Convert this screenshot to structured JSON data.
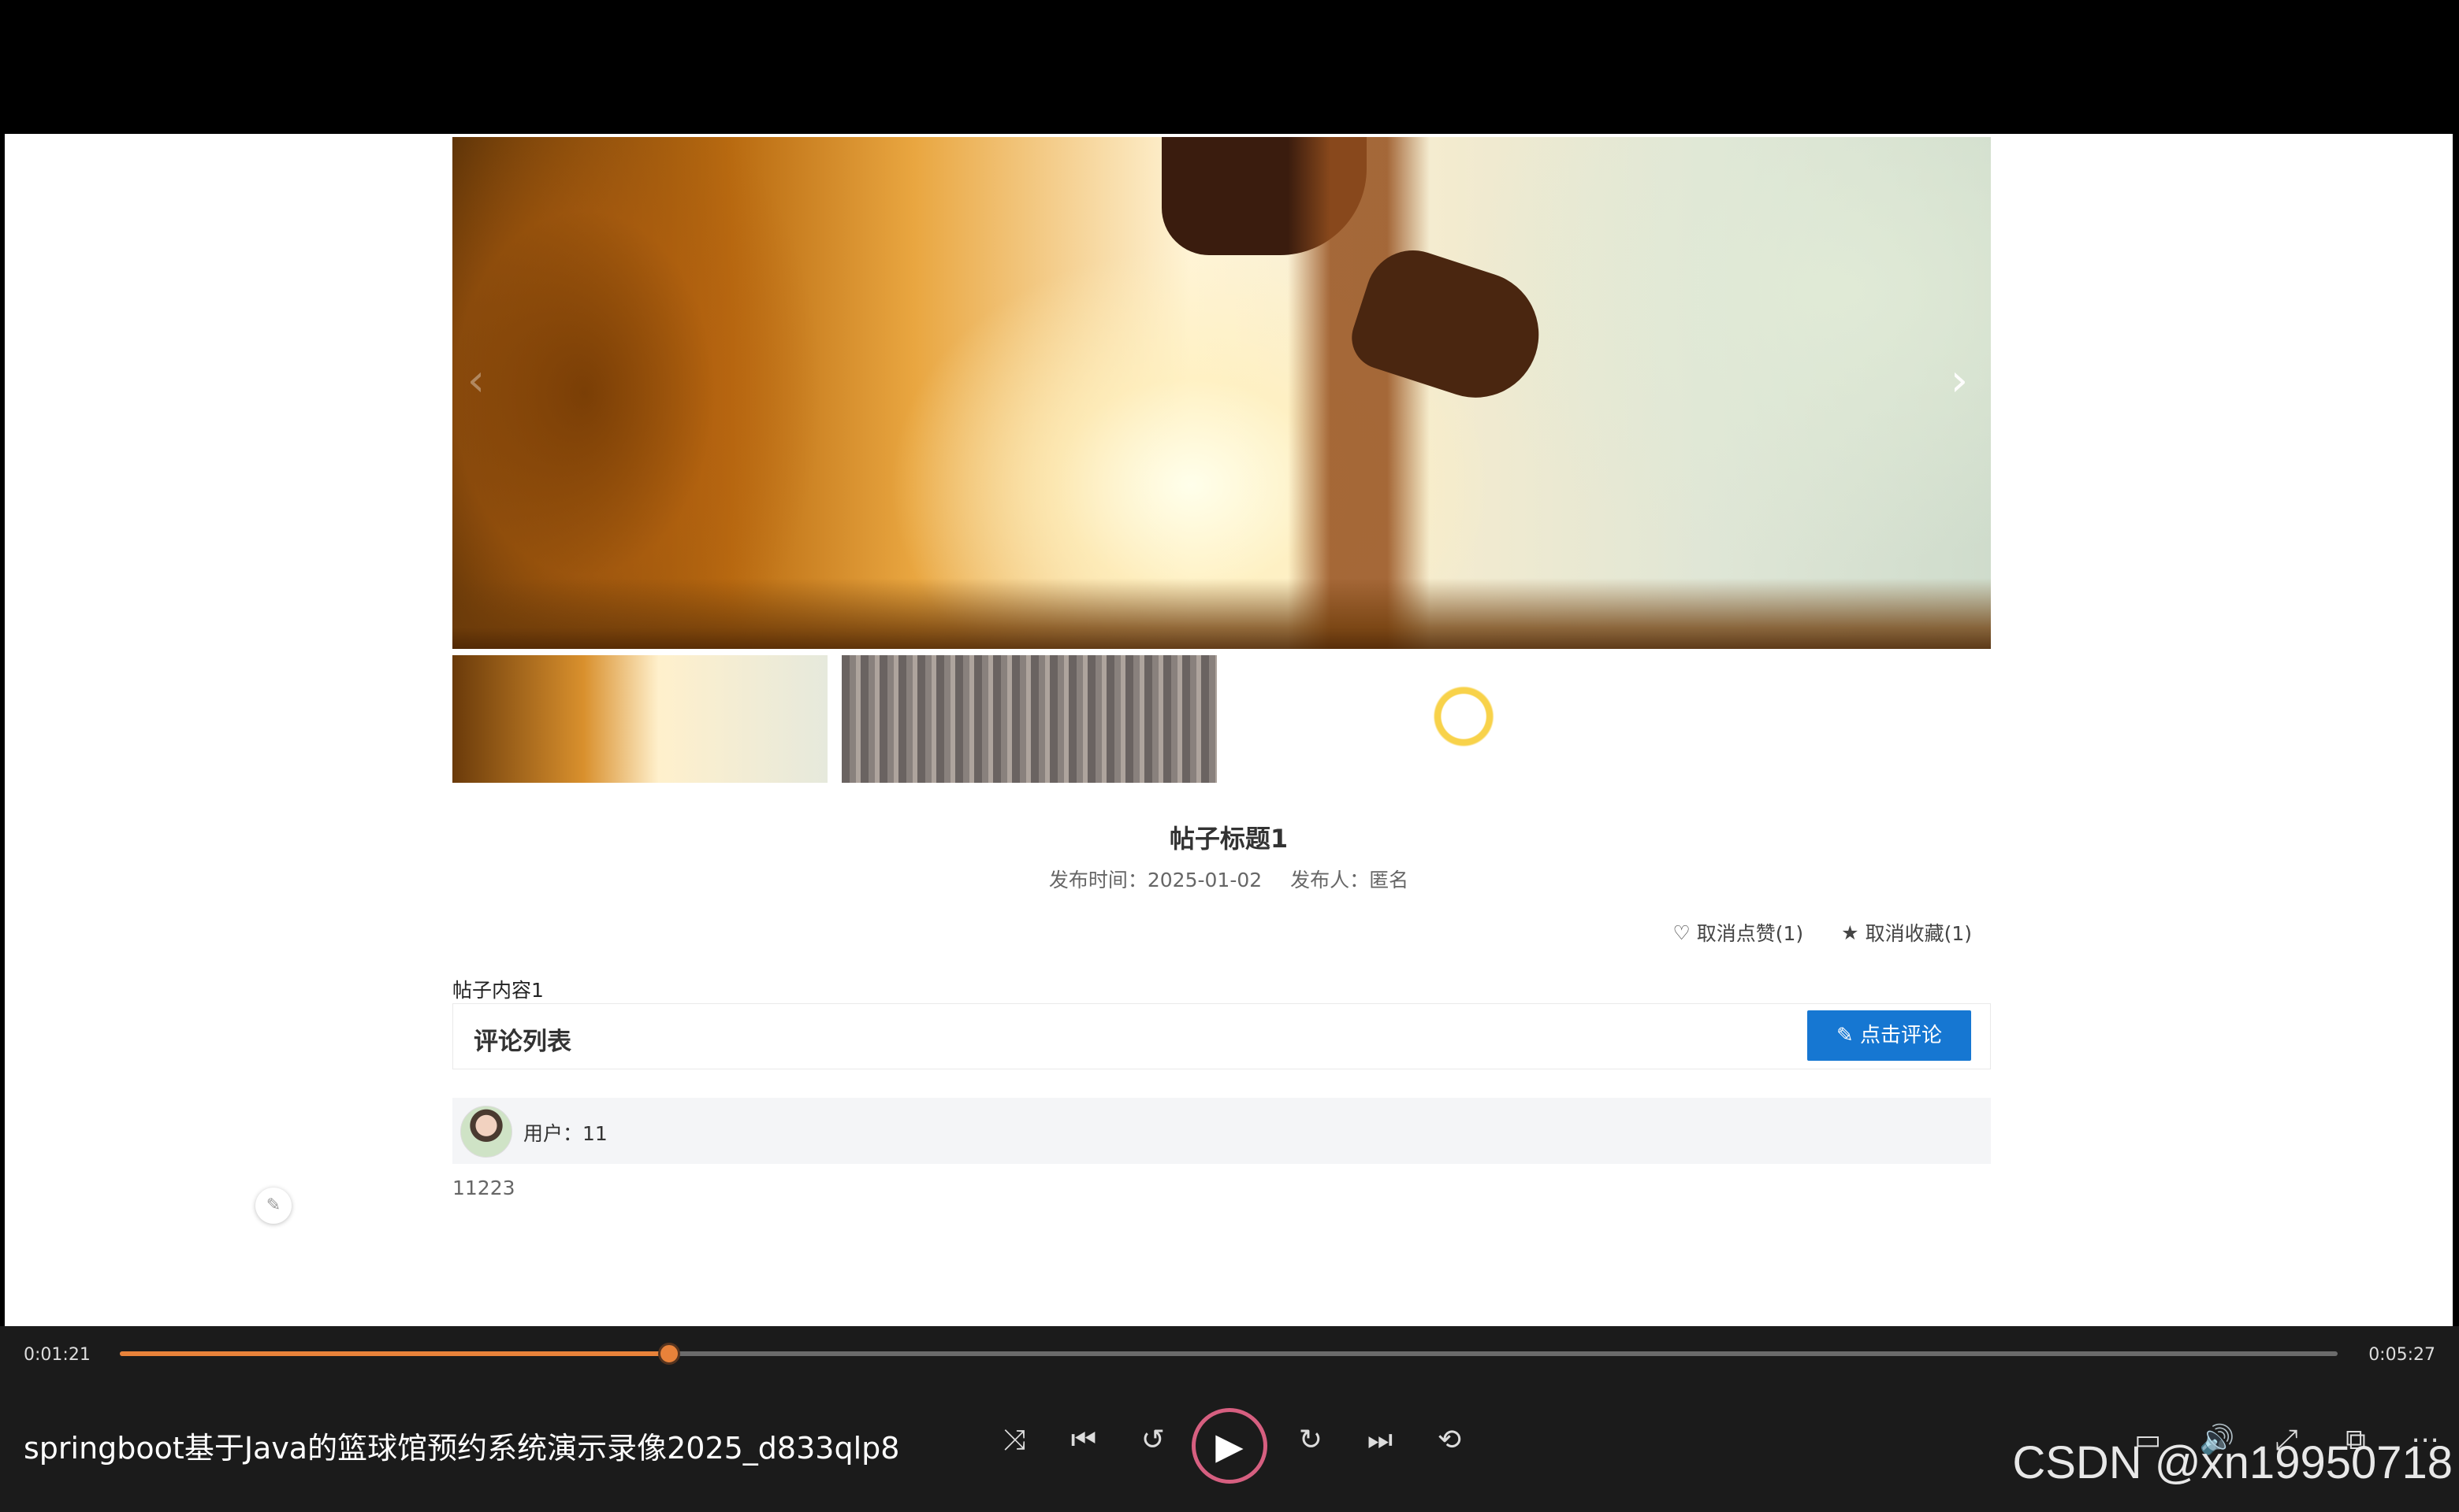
{
  "post": {
    "title": "帖子标题1",
    "publish_time": "发布时间：2025-01-02",
    "publisher": "发布人：匿名",
    "like_label": "取消点赞(1)",
    "collect_label": "取消收藏(1)",
    "content": "帖子内容1"
  },
  "comments": {
    "header": "评论列表",
    "button_label": "点击评论",
    "items": [
      {
        "user": "用户：11",
        "text": "11223"
      }
    ]
  },
  "player": {
    "current_time": "0:01:21",
    "total_time": "0:05:27",
    "progress": 0.2477,
    "video_title": "springboot基于Java的篮球馆预约系统演示录像2025_d833qlp8",
    "watermark": "CSDN @xn19950718"
  },
  "icons": {
    "carousel_prev": "chevron-left-icon",
    "carousel_next": "chevron-right-icon",
    "like": "heart-icon",
    "collect": "star-icon",
    "comment": "edit-icon",
    "shuffle": "shuffle-icon",
    "prev": "skip-previous-icon",
    "rewind": "rewind-10-icon",
    "play": "play-icon",
    "forward": "forward-30-icon",
    "next": "skip-next-icon",
    "repeat": "repeat-off-icon",
    "subtitles": "subtitles-icon",
    "volume": "volume-icon",
    "fullscreen": "fullscreen-icon",
    "miniplayer": "miniplayer-icon",
    "more": "more-icon"
  },
  "colors": {
    "accent_blue": "#1677d2",
    "progress_orange": "#e8823a",
    "play_ring": "#d65f80"
  }
}
